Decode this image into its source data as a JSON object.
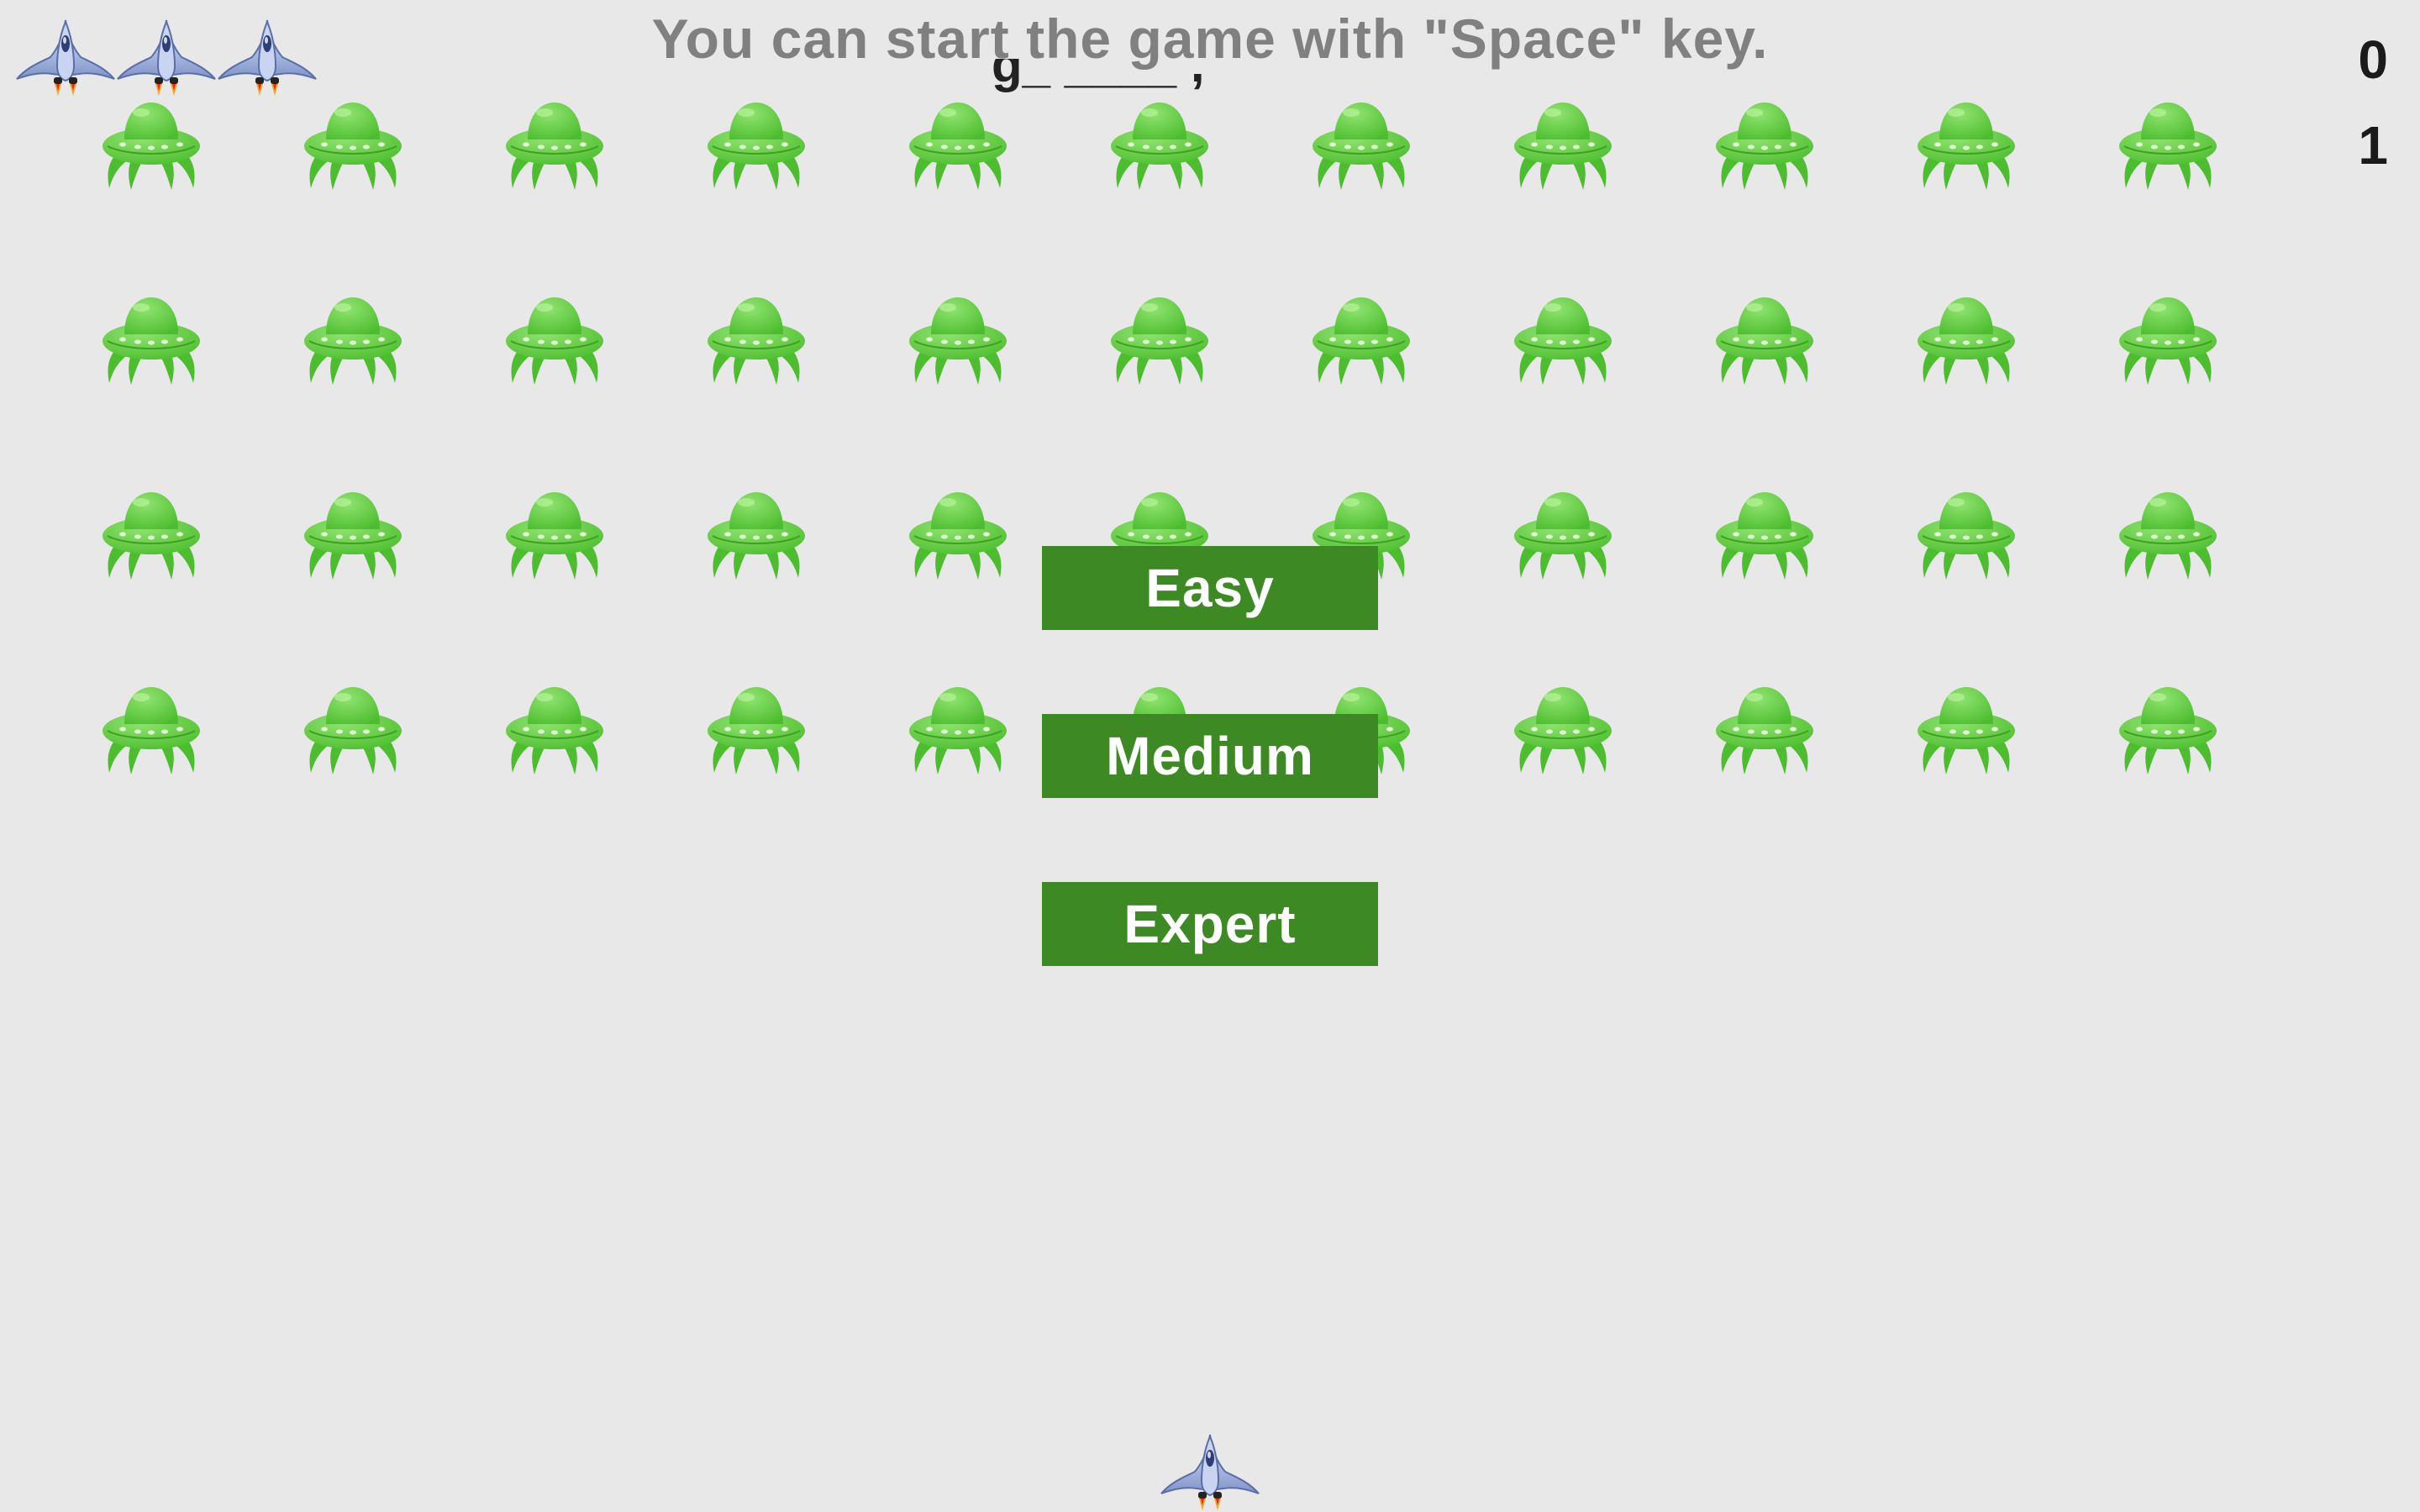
{
  "status": {
    "message": "You can start the game with \"Space\" key."
  },
  "scores": {
    "score_value": "0",
    "level_value": "1"
  },
  "lives": {
    "count": 3,
    "icon": "spaceship-icon"
  },
  "aliens": {
    "rows": 4,
    "columns": 11,
    "icon": "alien-ufo-icon",
    "color": "#5fcd3f"
  },
  "menu": {
    "easy_label": "Easy",
    "medium_label": "Medium",
    "expert_label": "Expert",
    "button_color": "#3d8a24"
  },
  "player": {
    "icon": "player-spaceship-icon"
  },
  "colors": {
    "background": "#e8e8e8",
    "message": "#808080",
    "ship_body": "#8fa3d6",
    "ship_flame": "#f5a623"
  }
}
